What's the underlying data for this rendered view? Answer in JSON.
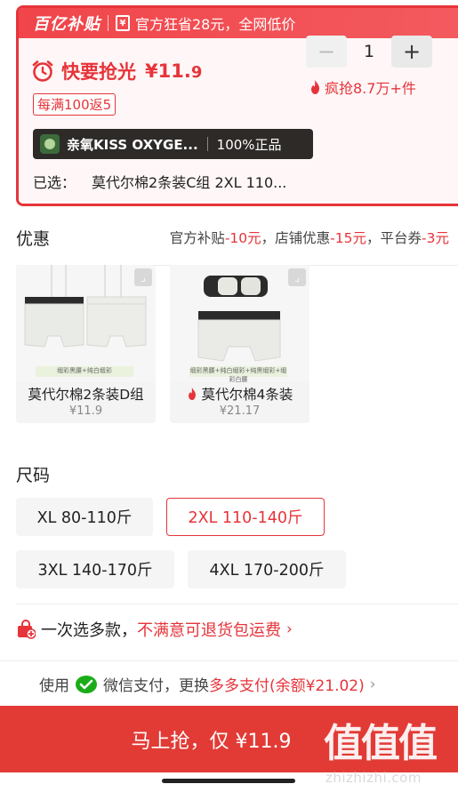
{
  "promo": {
    "logo": "百亿补贴",
    "badge_icon": "¥",
    "tagline": "官方狂省28元，全网低价",
    "flash_label": "快要抢光",
    "flash_price_main": "¥11.",
    "flash_price_decimal": "9",
    "rebate": "每满100返5",
    "brand_name": "亲氧KISS OXYGE...",
    "brand_genuine": "100%正品",
    "selected_label": "已选：",
    "selected_value": "莫代尔棉2条装C组 2XL 110..."
  },
  "quantity": {
    "minus": "−",
    "value": "1",
    "plus": "+"
  },
  "hot_sold": "疯抢8.7万+件",
  "discount": {
    "title": "优惠",
    "official_label": "官方补贴",
    "official_value": "-10元",
    "sep1": "，",
    "store_label": "店铺优惠",
    "store_value": "-15元",
    "sep2": "，",
    "platform_label": "平台券",
    "platform_value": "-3元"
  },
  "variants": [
    {
      "name": "莫代尔棉2条装D组",
      "price": "¥11.9",
      "caption": "缎彩黑腰+纯白缎彩"
    },
    {
      "name": "莫代尔棉4条装",
      "price": "¥21.17",
      "caption": "缎彩黑腰+纯白缎彩+纯黑缎彩+缎彩白腰"
    }
  ],
  "sizes": {
    "title": "尺码",
    "options": [
      "XL 80-110斤",
      "2XL 110-140斤",
      "3XL 140-170斤",
      "4XL 170-200斤"
    ],
    "selected_index": 1
  },
  "returns": {
    "text": "一次选多款，",
    "highlight": "不满意可退货包运费",
    "chevron": "›"
  },
  "payment": {
    "prefix": "使用",
    "wechat": "微信支付",
    "mid": "，更换",
    "alt": "多多支付(余额¥21.02)",
    "chevron": "›"
  },
  "buy_button": "马上抢，仅 ¥11.9",
  "watermark": {
    "title": "值值值",
    "url": "zhizhizhi.com"
  },
  "colors": {
    "accent": "#e6343a",
    "buy_bar": "#e23b36",
    "brand_bar": "#2d2a28"
  }
}
